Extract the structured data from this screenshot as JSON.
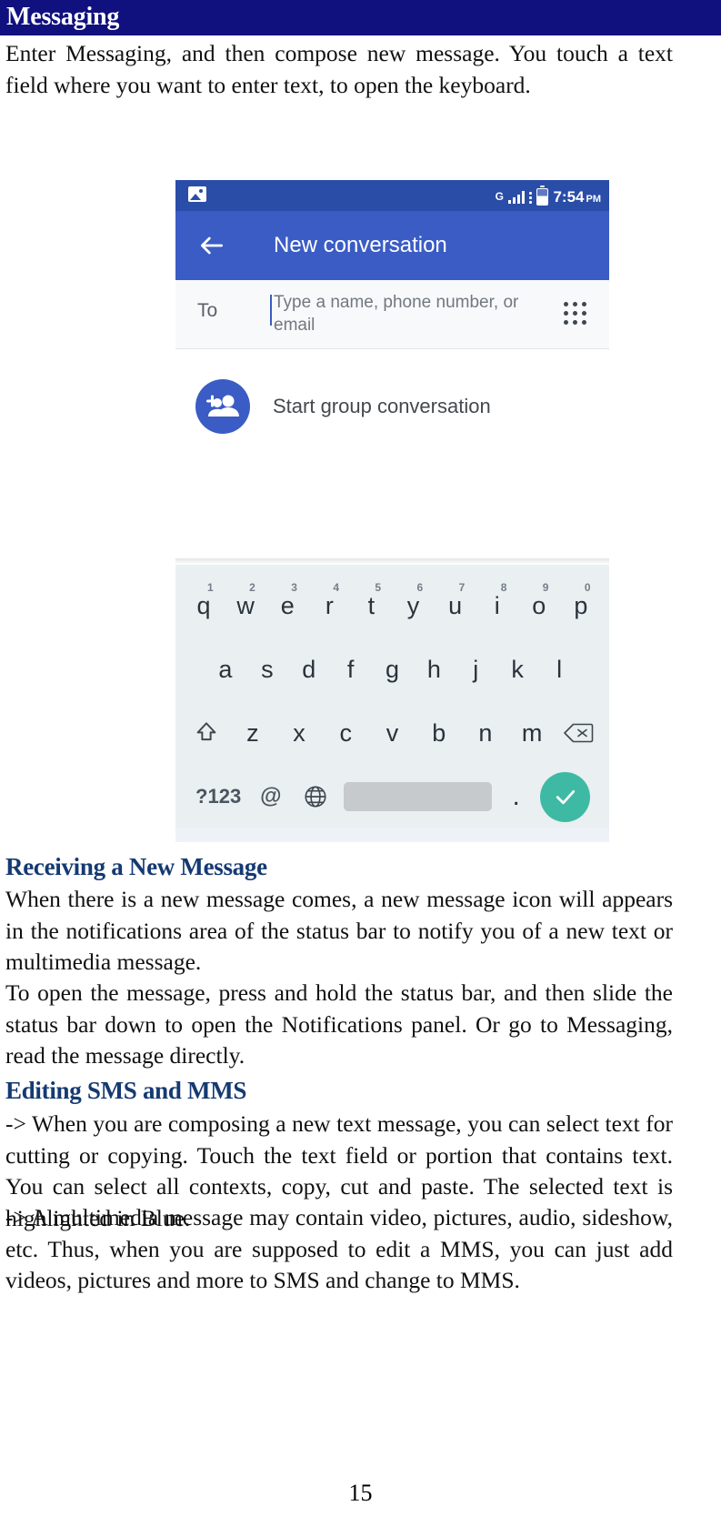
{
  "page": {
    "title": "Messaging",
    "number": "15"
  },
  "intro_paragraph": "Enter Messaging, and then compose new message. You touch a text field where you want to enter text, to open the keyboard.",
  "figure": {
    "status_bar": {
      "photo_icon": "photo-icon",
      "network_label": "G",
      "battery_icon": "battery-icon",
      "signal_icon": "signal-icon",
      "time": "7:54",
      "ampm": "PM"
    },
    "app_bar": {
      "back_icon": "back-arrow-icon",
      "title": "New conversation"
    },
    "to_row": {
      "label": "To",
      "placeholder": "Type a name, phone number, or email",
      "value": "",
      "dialpad_icon": "dialpad-icon"
    },
    "group_row": {
      "avatar_icon": "add-group-icon",
      "label": "Start group conversation"
    },
    "keyboard": {
      "row1": [
        {
          "key": "q",
          "sup": "1"
        },
        {
          "key": "w",
          "sup": "2"
        },
        {
          "key": "e",
          "sup": "3"
        },
        {
          "key": "r",
          "sup": "4"
        },
        {
          "key": "t",
          "sup": "5"
        },
        {
          "key": "y",
          "sup": "6"
        },
        {
          "key": "u",
          "sup": "7"
        },
        {
          "key": "i",
          "sup": "8"
        },
        {
          "key": "o",
          "sup": "9"
        },
        {
          "key": "p",
          "sup": "0"
        }
      ],
      "row2": [
        "a",
        "s",
        "d",
        "f",
        "g",
        "h",
        "j",
        "k",
        "l"
      ],
      "row3": {
        "shift_icon": "shift-icon",
        "letters": [
          "z",
          "x",
          "c",
          "v",
          "b",
          "n",
          "m"
        ],
        "backspace_icon": "backspace-icon"
      },
      "row4": {
        "symbols_key": "?123",
        "at_key": "@",
        "globe_icon": "globe-icon",
        "space_key": "space-bar",
        "period_key": ".",
        "enter_icon": "check-icon"
      }
    }
  },
  "sections": [
    {
      "heading": "Receiving a New Message",
      "paragraphs": [
        "When there is a new message comes, a new message icon will appears in the notifications area of the status bar to notify you of a new text or multimedia message.",
        "To open the message, press and hold the status bar, and then slide the status bar down to open the Notifications panel. Or go to Messaging, read the message directly."
      ]
    },
    {
      "heading": "Editing SMS and MMS",
      "paragraphs": [
        "-> When you are composing a new text message, you can select text for cutting or copying. Touch the text field or portion that contains text. You can select all contexts, copy, cut and paste. The selected text is highlighted in Blue.",
        "-> A multimedia message may contain video, pictures, audio, sideshow, etc. Thus, when you are supposed to edit a MMS, you can just add videos, pictures and more to SMS and change to MMS."
      ]
    }
  ],
  "colors": {
    "title_bar_bg": "#10107e",
    "heading": "#153a72",
    "status_bar_bg": "#2a4da8",
    "app_bar_bg": "#3b5cc4",
    "accent_blue": "#3b5cc4",
    "enter_green": "#3ebaa4",
    "keyboard_bg": "#eaeff1"
  }
}
